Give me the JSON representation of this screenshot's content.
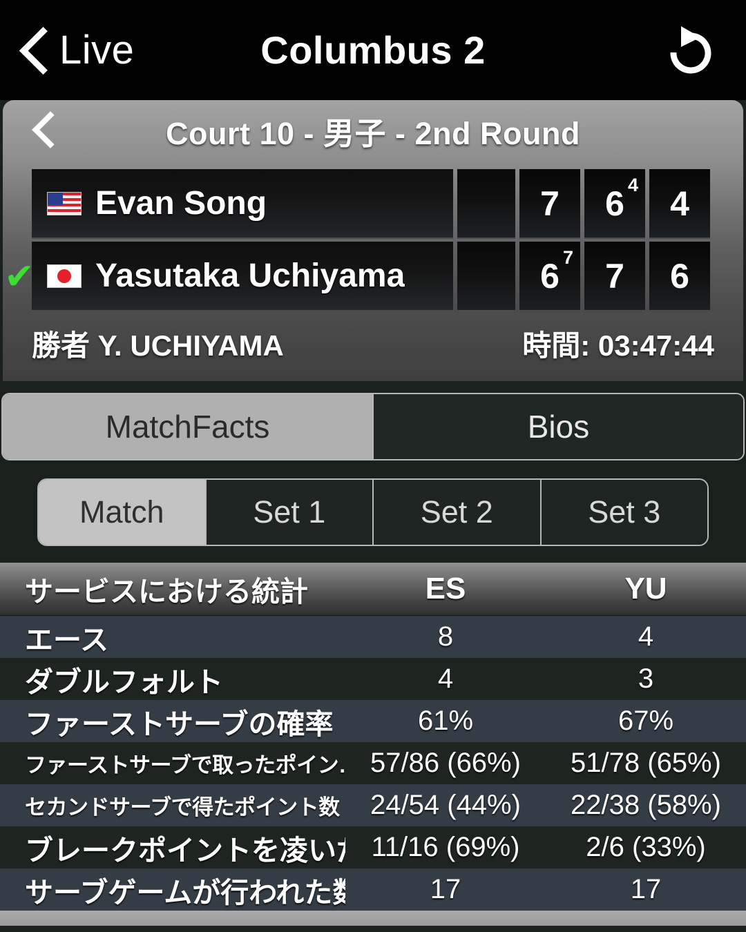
{
  "navbar": {
    "back_label": "Live",
    "title": "Columbus 2",
    "refresh_icon": "refresh-icon",
    "back_icon": "chevron-left-icon"
  },
  "court_header": {
    "back_icon": "chevron-left-icon",
    "title": "Court 10 - 男子 - 2nd Round"
  },
  "scoreboard": {
    "players": [
      {
        "name": "Evan Song",
        "flag": "us-flag",
        "winner": false,
        "winner_mark": "",
        "serve_indicator": "",
        "sets": [
          {
            "game": "7",
            "tiebreak": ""
          },
          {
            "game": "6",
            "tiebreak": "4"
          },
          {
            "game": "4",
            "tiebreak": ""
          }
        ]
      },
      {
        "name": "Yasutaka Uchiyama",
        "flag": "jp-flag",
        "winner": true,
        "winner_mark": "✔",
        "serve_indicator": "",
        "sets": [
          {
            "game": "6",
            "tiebreak": "7"
          },
          {
            "game": "7",
            "tiebreak": ""
          },
          {
            "game": "6",
            "tiebreak": ""
          }
        ]
      }
    ],
    "winner_line": "勝者 Y. UCHIYAMA",
    "duration_line": "時間: 03:47:44"
  },
  "main_tabs": {
    "items": [
      {
        "label": "MatchFacts",
        "selected": true
      },
      {
        "label": "Bios",
        "selected": false
      }
    ]
  },
  "set_tabs": {
    "items": [
      {
        "label": "Match",
        "selected": true
      },
      {
        "label": "Set 1",
        "selected": false
      },
      {
        "label": "Set 2",
        "selected": false
      },
      {
        "label": "Set 3",
        "selected": false
      }
    ]
  },
  "stats_table": {
    "header": {
      "label": "サービスにおける統計",
      "col1": "ES",
      "col2": "YU"
    },
    "rows": [
      {
        "label": "エース",
        "small": false,
        "es": "8",
        "yu": "4"
      },
      {
        "label": "ダブルフォルト",
        "small": false,
        "es": "4",
        "yu": "3"
      },
      {
        "label": "ファーストサーブの確率",
        "small": false,
        "es": "61%",
        "yu": "67%"
      },
      {
        "label": "ファーストサーブで取ったポイン…",
        "small": true,
        "es": "57/86 (66%)",
        "yu": "51/78 (65%)"
      },
      {
        "label": "セカンドサーブで得たポイント数",
        "small": true,
        "es": "24/54 (44%)",
        "yu": "22/38 (58%)"
      },
      {
        "label": "ブレークポイントを凌いだ数",
        "small": false,
        "es": "11/16 (69%)",
        "yu": "2/6 (33%)"
      },
      {
        "label": "サーブゲームが行われた数",
        "small": false,
        "es": "17",
        "yu": "17"
      }
    ]
  },
  "colors": {
    "accent_green": "#3ddd33",
    "selected_tab_bg": "#b0b0b0",
    "row_alt_a": "#343c45",
    "row_alt_b": "#1e2521",
    "page_bg": "#1a211d"
  }
}
